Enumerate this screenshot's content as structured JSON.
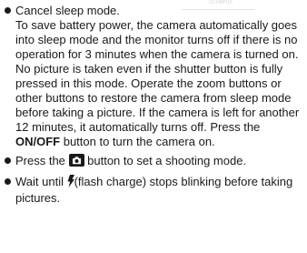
{
  "background_label": "OLYMPUS",
  "items": [
    {
      "heading": "Cancel sleep mode.",
      "body_part1": "To save battery power, the camera automatically goes into sleep mode and the monitor turns off if there is no operation for 3 minutes when the camera is turned on. No picture is taken even if the shutter button is fully pressed in this mode. Operate the zoom buttons or other buttons to restore the camera from sleep mode before taking a picture. If the camera is left for another 12 minutes, it automatically turns off. Press the ",
      "body_bold": "ON/OFF",
      "body_part2": " button to turn the camera on."
    },
    {
      "text_before": "Press the ",
      "icon": "camera-icon",
      "text_after": " button to set a shooting mode."
    },
    {
      "text_before": "Wait until ",
      "icon": "flash-icon",
      "text_after": "(flash charge) stops blinking before taking pictures."
    }
  ]
}
